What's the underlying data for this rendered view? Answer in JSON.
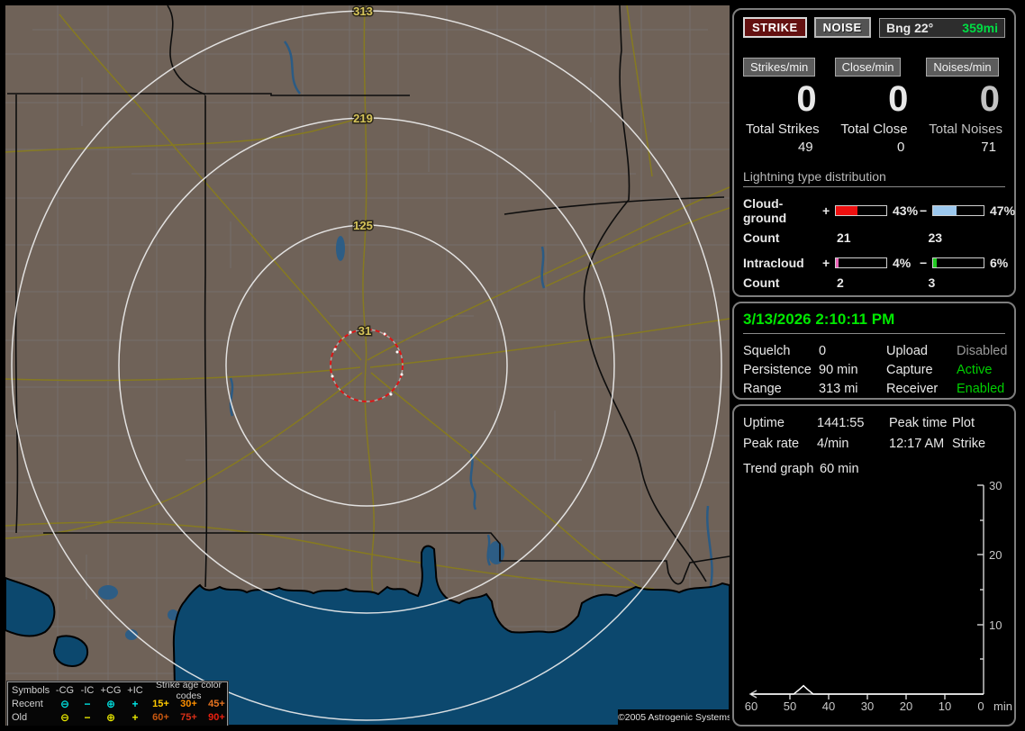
{
  "header": {
    "strike_btn": "STRIKE",
    "noise_btn": "NOISE",
    "bng_label": "Bng 22°",
    "bng_range": "359mi",
    "accent_green": "#00dd44",
    "strike_btn_color": "#641111"
  },
  "stats": {
    "columns": [
      {
        "chip": "Strikes/min",
        "rate": "0",
        "total_label": "Total Strikes",
        "total": "49"
      },
      {
        "chip": "Close/min",
        "rate": "0",
        "total_label": "Total Close",
        "total": "0"
      },
      {
        "chip": "Noises/min",
        "rate": "0",
        "total_label": "Total Noises",
        "total": "71"
      }
    ]
  },
  "distribution": {
    "title": "Lightning type distribution",
    "plus_sign": "+",
    "minus_sign": "−",
    "rows": [
      {
        "label": "Cloud-ground",
        "pos_pct": "43%",
        "pos_fill": 43,
        "pos_color": "#ee1010",
        "neg_pct": "47%",
        "neg_fill": 47,
        "neg_color": "#9cc8ee",
        "count_label": "Count",
        "pos_count": "21",
        "neg_count": "23"
      },
      {
        "label": "Intracloud",
        "pos_pct": "4%",
        "pos_fill": 5,
        "pos_color": "#ee66bb",
        "neg_pct": "6%",
        "neg_fill": 7,
        "neg_color": "#22cc22",
        "count_label": "Count",
        "pos_count": "2",
        "neg_count": "3"
      }
    ]
  },
  "status": {
    "datetime": "3/13/2026 2:10:11 PM",
    "rows": [
      {
        "l1": "Squelch",
        "v1": "0",
        "l2": "Upload",
        "v2": "Disabled",
        "v2_color": "#9a9a9a"
      },
      {
        "l1": "Persistence",
        "v1": "90 min",
        "l2": "Capture",
        "v2": "Active",
        "v2_color": "#00d000"
      },
      {
        "l1": "Range",
        "v1": "313 mi",
        "l2": "Receiver",
        "v2": "Enabled",
        "v2_color": "#00d000"
      }
    ]
  },
  "session": {
    "rows": [
      {
        "l1": "Uptime",
        "v1": "1441:55",
        "l2": "Peak time",
        "v2": "Plot"
      },
      {
        "l1": "Peak rate",
        "v1": "4/min",
        "l2": "12:17 AM",
        "v2": "Strike"
      }
    ],
    "trend_label": "Trend graph",
    "trend_value": "60 min"
  },
  "chart_data": {
    "type": "line",
    "title": "Strike rate trend graph (last 60 min)",
    "xlabel": "min",
    "ylabel": "",
    "x_unit": "min",
    "xlim": [
      60,
      0
    ],
    "ylim": [
      0,
      30
    ],
    "xticks": [
      60,
      50,
      40,
      30,
      20,
      10,
      0
    ],
    "yticks": [
      30,
      20,
      10
    ],
    "grid": false,
    "legend_position": "none",
    "axis_color": "#c8c8c8",
    "series": [
      {
        "name": "Strike",
        "points": [
          [
            60,
            0
          ],
          [
            49,
            0
          ],
          [
            47.5,
            0.7
          ],
          [
            46.5,
            1.2
          ],
          [
            45.5,
            0.7
          ],
          [
            44,
            0
          ],
          [
            0,
            0
          ]
        ]
      }
    ]
  },
  "map": {
    "ring_labels": [
      "313",
      "219",
      "125",
      "31"
    ],
    "ring_radii_mi": [
      313,
      219,
      125,
      31
    ],
    "ring_color": "#ececec",
    "ring_label_color": "#d6c45a",
    "alarm_ring_color": "#dd1515",
    "land_color": "#6f6258",
    "water_color": "#0c486e",
    "road_color": "#867a20",
    "copyright": "©2005 Astrogenic Systems",
    "legend": {
      "header_symbols": "Symbols",
      "header_cols": [
        "-CG",
        "-IC",
        "+CG",
        "+IC"
      ],
      "header_age": "Strike age color codes",
      "rows": [
        {
          "label": "Recent",
          "color": "#00e5e5",
          "symbols": [
            "⊖",
            "−",
            "⊕",
            "+"
          ],
          "ages": [
            {
              "text": "15+",
              "color": "#ffc800"
            },
            {
              "text": "30+",
              "color": "#ff9000"
            },
            {
              "text": "45+",
              "color": "#e87420"
            }
          ]
        },
        {
          "label": "Old",
          "color": "#e8e800",
          "symbols": [
            "⊖",
            "−",
            "⊕",
            "+"
          ],
          "ages": [
            {
              "text": "60+",
              "color": "#c85810"
            },
            {
              "text": "75+",
              "color": "#d83018"
            },
            {
              "text": "90+",
              "color": "#e82010"
            }
          ]
        }
      ]
    }
  }
}
